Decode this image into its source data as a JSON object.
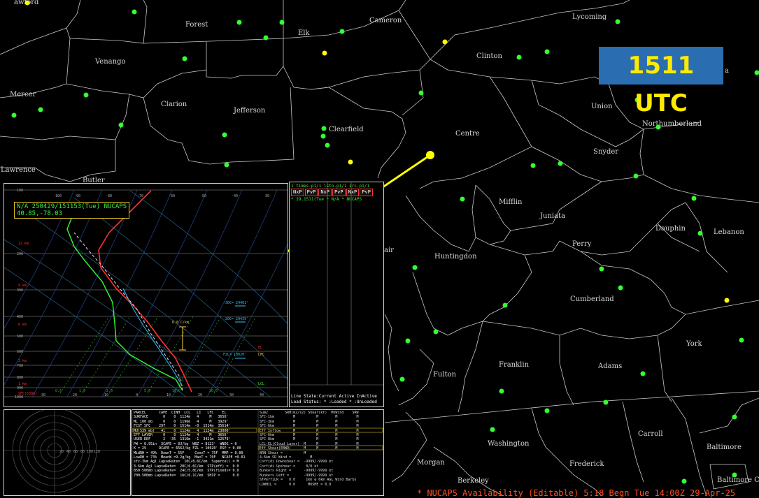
{
  "utc_badge": "1511 UTC",
  "counties": [
    "awford",
    "Forest",
    "Elk",
    "Cameron",
    "Lycoming",
    "Venango",
    "Mercer",
    "Clarion",
    "Jefferson",
    "Clearfield",
    "Clinton",
    "Centre",
    "Union",
    "Northumberland",
    "Snyder",
    "Lawrence",
    "Butler",
    "Mifflin",
    "Juniata",
    "Dauphin",
    "Lebanon",
    "Perry",
    "Huntingdon",
    "Cumberland",
    "Franklin",
    "Adams",
    "Fulton",
    "York",
    "Washington",
    "Carroll",
    "Baltimore",
    "Frederick",
    "Morgan",
    "Berkeley",
    "Baltimore City",
    "a",
    "air"
  ],
  "colors": {
    "station_green": "#33ff33",
    "station_yellow": "#ffff00",
    "line_yellow": "#ffff00",
    "badge_bg": "#2a6db0",
    "badge_text": "#ffeb00"
  },
  "skewt": {
    "label_line1": "N/A 250429/151153(Tue) NUCAPS",
    "label_line2": "40.85,-78.03",
    "pressure_ticks": [
      "100",
      "200",
      "300",
      "400",
      "500",
      "600",
      "700",
      "800",
      "900",
      "1000"
    ],
    "height_ticks": [
      "12 km",
      "9 km",
      "6 km",
      "3 km",
      "1 km",
      "SFC(539m)"
    ],
    "temp_ticks_top": [
      "-100",
      "-90",
      "-80",
      "-70",
      "-60",
      "-50",
      "-40",
      "-30"
    ],
    "temp_ticks_bottom": [
      "-30",
      "-20",
      "-10",
      "0",
      "10",
      "20",
      "30",
      "40"
    ],
    "mixing_ratio": [
      "0.5",
      "1.0",
      "2.0",
      "5.0",
      "10.0",
      "20.0"
    ],
    "annotations": [
      "-30C= 24401'",
      "-20C= 20439'",
      "FZL= 10020'",
      "6.8 C/km",
      "EL",
      "LFC",
      "LCL"
    ]
  },
  "times_list": {
    "header": "1 times.p1/1  lsto.p1/1 src.p1/1",
    "buttons": [
      "NxP",
      "PvP",
      "NxP",
      "PvP",
      "NxP",
      "PvP"
    ],
    "row": "* 29.1511(Tue  * N/A      * NUCAPS",
    "line_state": "Line State:Current Active InActive",
    "load_status": "Load Status: * :Loaded * :UnLoaded"
  },
  "hodograph": {
    "ticks": [
      "20",
      "40",
      "60",
      "80",
      "100",
      "120"
    ]
  },
  "params": {
    "col1": "PARCEL      CAPE  CINH  LCL   LI   LFC    EL\nSURFACE       0    0  1124m   4     M   3656'\nML 100 mb     0    0  1196m   4     M   3929'\nFCST SFC    297    0  1514m  -0  1514m  35614'\nMU(539 mb)   41    0  1124m   4  1124m  23000'\nEFF LAYER     0    0  1124m   4     M   3656'\nUSER DEF      2  -35  1316m  -1  3421m  12579'\nPW = 0.95in  3CAPE = 0J/kg  WBZ = 8123'  WNDG = 0\nK = 29      DCAPE = 656J/kg FZL = 10020' ESP = 0.00\nMidRH = 49%  DownT = 55F     ConvT = 75F  MMP = 0.00\nLowRH = 73%  MeanW =9.2g/kg  MaxT = 70F   NCAPE =0.01\nsfc-3km Agl LapseRate=  10C/8.6C/km  Supercell = M\n3-6km Agl LapseRate=  20C/6.6C/km  STP(eff) =  0.0\n850-500mb LapseRate=  24C/5.8C/km  STP(fixed)= 0.0\n700-500mb LapseRate=  16C/6.1C/km  SHIP =      0.0",
    "col2": "Sum2        SRH(m2/s2) Shear(kt)  MnWind    SRW\nSFC-1km         M          M        M         M\nSFC-3km         M          M        M         M\nSFC-6km         M          M        M         M\nEff Inflow      M          M        M         M\nSFC-6km         M          M        M         M\nSFC-8km         M          M        M         M\nLCL-EL(Cloud Layer)  M     M        M         M\nEff Shear(EBWD)      M     M        M         M\nBRN Shear =          M\n4-6km SR Wind =         M\nCorfidi Downshear =  -9999/-9999 kt\nCorfidi Upshear =     0/0 kt\nBunkers Right =      -9999/-9999 kt\nBunkers Left =       -9999/-9999 kt\nSTPeff1LR =   0.0     1km & 6km AGL Wind Barbs\nLOWHIL =      0.0      MOSHE = 0.0"
  },
  "status_bar": "* NUCAPS Availability (Editable)   5:18 Begn Tue 14:00Z 29-Apr-25"
}
